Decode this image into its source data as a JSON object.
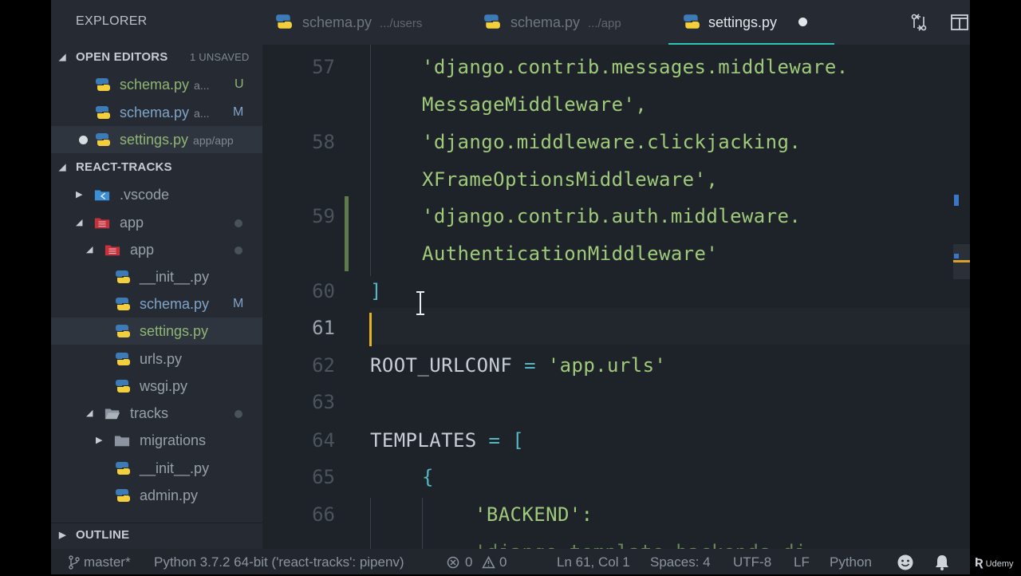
{
  "sidebar": {
    "title": "EXPLORER",
    "open_editors": {
      "label": "OPEN EDITORS",
      "note": "1 UNSAVED",
      "items": [
        {
          "name": "schema.py",
          "desc": "a...",
          "status": "U"
        },
        {
          "name": "schema.py",
          "desc": "a...",
          "status": "M"
        },
        {
          "name": "settings.py",
          "desc": "app/app",
          "status": ""
        }
      ]
    },
    "project": {
      "label": "REACT-TRACKS",
      "tree": [
        {
          "name": ".vscode"
        },
        {
          "name": "app"
        },
        {
          "name": "app"
        },
        {
          "name": "__init__.py"
        },
        {
          "name": "schema.py",
          "status": "M"
        },
        {
          "name": "settings.py"
        },
        {
          "name": "urls.py"
        },
        {
          "name": "wsgi.py"
        },
        {
          "name": "tracks"
        },
        {
          "name": "migrations"
        },
        {
          "name": "__init__.py"
        },
        {
          "name": "admin.py"
        }
      ]
    },
    "outline": {
      "label": "OUTLINE"
    }
  },
  "tabs": [
    {
      "name": "schema.py",
      "desc": ".../users"
    },
    {
      "name": "schema.py",
      "desc": ".../app"
    },
    {
      "name": "settings.py",
      "desc": ""
    }
  ],
  "editor": {
    "line_numbers": [
      "57",
      "58",
      "59",
      "60",
      "61",
      "62",
      "63",
      "64",
      "65",
      "66"
    ],
    "lines": [
      "'django.contrib.messages.middleware.",
      "MessageMiddleware',",
      "'django.middleware.clickjacking.",
      "XFrameOptionsMiddleware',",
      "'django.contrib.auth.middleware.",
      "AuthenticationMiddleware'",
      "]",
      "",
      "ROOT_URLCONF",
      "=",
      "'app.urls'",
      "TEMPLATES",
      "=",
      "[",
      "{",
      "'BACKEND':"
    ]
  },
  "statusbar": {
    "branch": "master*",
    "interpreter": "Python 3.7.2 64-bit ('react-tracks': pipenv)",
    "errors": "0",
    "warnings": "0",
    "position": "Ln 61, Col 1",
    "spaces": "Spaces: 4",
    "encoding": "UTF-8",
    "eol": "LF",
    "language": "Python"
  },
  "watermark": "Udemy",
  "colors": {
    "accent": "#2ec6b8",
    "string": "#9fca7a",
    "caret": "#e6b422",
    "untracked": "#8fb573",
    "modified": "#7ea4c8"
  }
}
